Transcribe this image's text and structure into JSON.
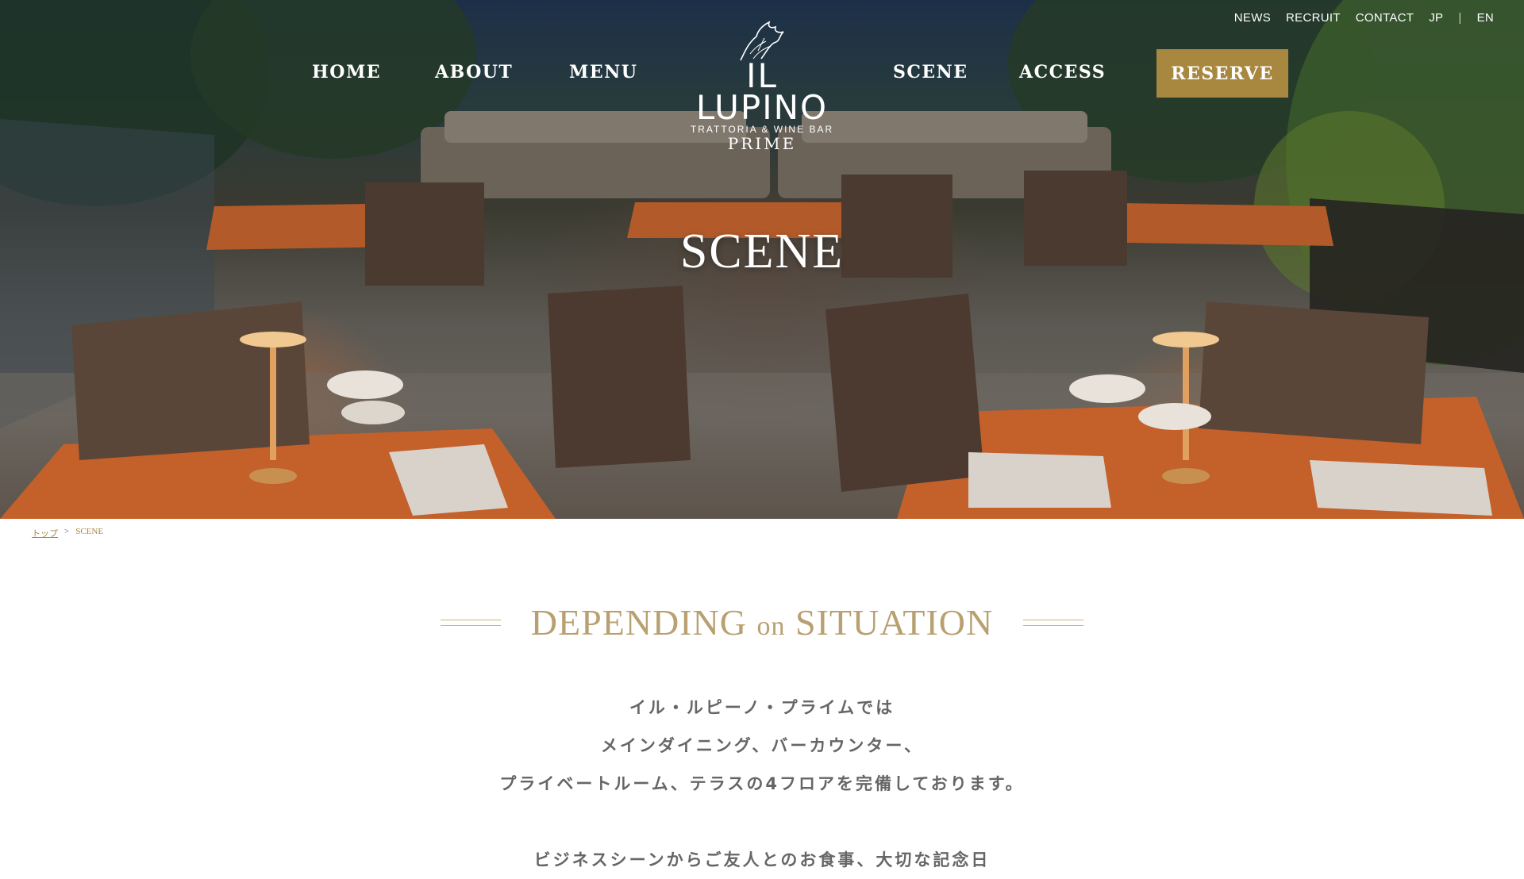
{
  "utility_nav": {
    "news": "NEWS",
    "recruit": "RECRUIT",
    "contact": "CONTACT",
    "jp": "JP",
    "separator": "|",
    "en": "EN"
  },
  "main_nav": {
    "home": "HOME",
    "about": "ABOUT",
    "menu": "MENU",
    "scene": "SCENE",
    "access": "ACCESS",
    "reserve": "RESERVE"
  },
  "logo": {
    "name": "IL LUPINO",
    "tagline": "TRATTORIA & WINE BAR",
    "sub": "PRIME",
    "icon": "wolf-icon"
  },
  "hero": {
    "title": "SCENE"
  },
  "breadcrumb": {
    "home": "トップ",
    "separator": ">",
    "current": "SCENE"
  },
  "section": {
    "title_part1": "DEPENDING ",
    "title_part2": "on",
    "title_part3": " SITUATION",
    "lines": [
      "イル・ルピーノ・プライムでは",
      "メインダイニング、バーカウンター、",
      "プライベートルーム、テラスの4フロアを完備しております。",
      "ビジネスシーンからご友人とのお食事、大切な記念日"
    ]
  },
  "colors": {
    "accent_gold": "#a8873f",
    "heading_gold": "#b8a070",
    "body_text": "#666666"
  }
}
